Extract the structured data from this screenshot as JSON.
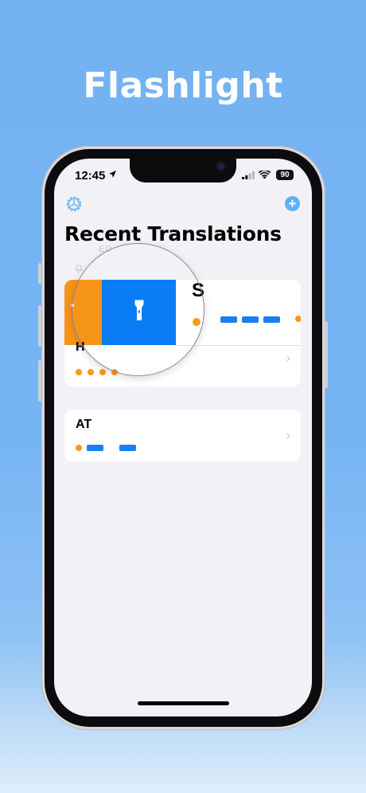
{
  "headline": "Flashlight",
  "status_bar": {
    "time": "12:45",
    "battery": "90"
  },
  "nav": {
    "settings_icon": "gear-icon",
    "add_icon": "plus-circle-icon",
    "add_symbol": "+"
  },
  "page": {
    "title": "Recent Translations",
    "section_label": "ED"
  },
  "items": [
    {
      "label": "S",
      "hidden_label": "H",
      "pinned": true
    },
    {
      "label": "AT"
    }
  ],
  "swipe_action": {
    "icon": "flashlight-icon",
    "color": "#0a7cf6",
    "secondary_color": "#f7941a"
  },
  "morse_colors": {
    "dot": "#f79a14",
    "dash": "#1a7ef7"
  },
  "chevron": "›"
}
